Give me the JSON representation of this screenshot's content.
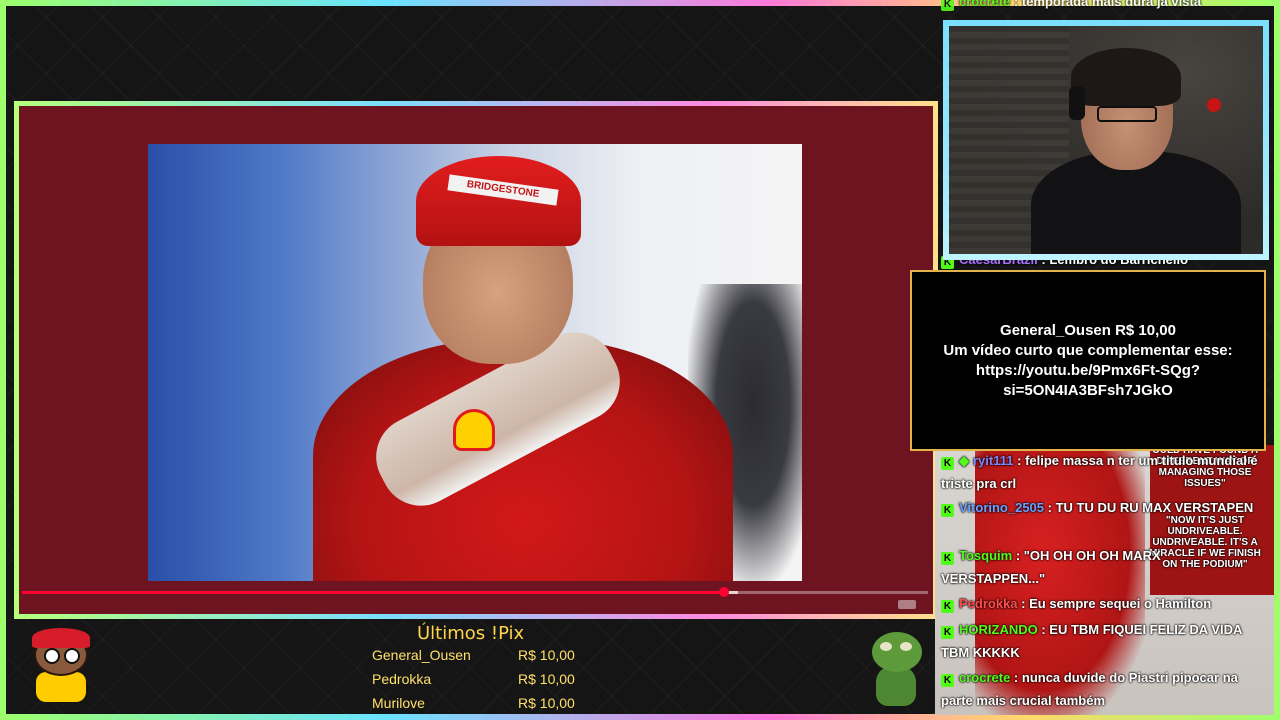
{
  "video": {
    "cap_brand": "BRIDGESTONE",
    "progress_percent": 77.5
  },
  "alert": {
    "line1": "General_Ousen R$ 10,00",
    "line2": "Um vídeo curto que complementar esse:",
    "line3": "https://youtu.be/9Pmx6Ft-SQg?",
    "line4": "si=5ON4IA3BFsh7JGkO"
  },
  "chat": {
    "partial_top": {
      "user": "crocrete",
      "text": "temporada mais dura já vista",
      "color": "#53fc18"
    },
    "partial_mid": {
      "user": "CaesarBrazil",
      "text": "Lembro do Barrichello",
      "color": "#a970ff"
    },
    "messages": [
      {
        "user": "ryit111",
        "text": "felipe massa n ter um titulo mundial é triste pra crl",
        "color": "#7e86ff",
        "gem": true
      },
      {
        "user": "Vitorino_2505",
        "text": "TU TU DU RU MAX VERSTAPEN",
        "color": "#6aa0ff",
        "gem": false
      },
      {
        "user": "Tosquim",
        "text": "\"OH OH OH OH MARX VERSTAPPEN...\"",
        "color": "#53fc18",
        "gem": false
      },
      {
        "user": "Pedrokka",
        "text": "Eu sempre sequei o Hamilton",
        "color": "#ff4d4d",
        "gem": false
      },
      {
        "user": "HORIZANDO",
        "text": "EU TBM FIQUEI FELIZ DA VIDA TBM KKKKK",
        "color": "#53fc18",
        "gem": false
      },
      {
        "user": "crocrete",
        "text": "nunca duvide do Piastri pipocar na parte mais crucial também",
        "color": "#53fc18",
        "gem": false
      }
    ],
    "art_quotes": [
      "OULD HAVE FOUND A DIFFERENT WAY OF MANAGING THOSE ISSUES\"",
      "\"NOW IT'S JUST UNDRIVEABLE. UNDRIVEABLE. IT'S A MIRACLE IF WE FINISH ON THE PODIUM\""
    ]
  },
  "pix": {
    "title": "Últimos !Pix",
    "entries": [
      {
        "name": "General_Ousen",
        "amount": "R$ 10,00"
      },
      {
        "name": "Pedrokka",
        "amount": "R$ 10,00"
      },
      {
        "name": "Murilove",
        "amount": "R$ 10,00"
      }
    ]
  },
  "icons": {
    "chat_platform": "kick-icon",
    "badge": "gem-icon"
  },
  "colors": {
    "frame_accent": "#7adfff",
    "alert_border": "#e0b44a",
    "pix_text": "#ffe16a"
  }
}
